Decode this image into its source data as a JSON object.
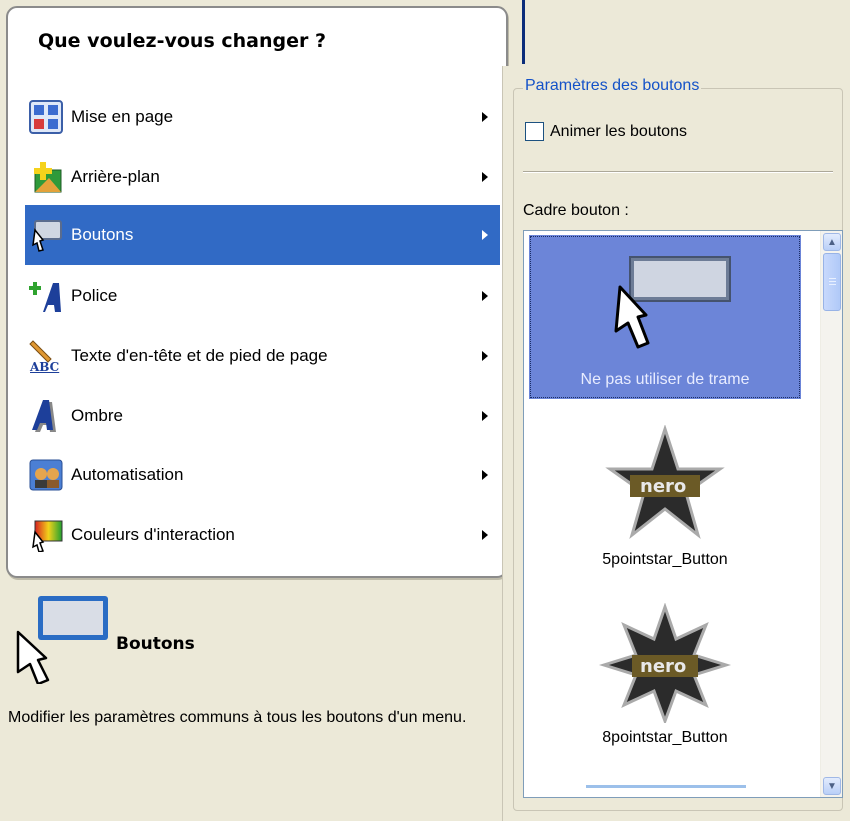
{
  "menu": {
    "title": "Que voulez-vous changer ?",
    "items": [
      {
        "label": "Mise en page",
        "icon": "layout-icon"
      },
      {
        "label": "Arrière-plan",
        "icon": "background-icon"
      },
      {
        "label": "Boutons",
        "icon": "buttons-icon",
        "selected": true
      },
      {
        "label": "Police",
        "icon": "font-icon"
      },
      {
        "label": "Texte d'en-tête et de pied de page",
        "icon": "header-footer-icon"
      },
      {
        "label": "Ombre",
        "icon": "shadow-icon"
      },
      {
        "label": "Automatisation",
        "icon": "automation-icon"
      },
      {
        "label": "Couleurs d'interaction",
        "icon": "interaction-colors-icon"
      }
    ]
  },
  "info": {
    "title": "Boutons",
    "description": "Modifier les paramètres communs à tous les boutons d'un menu."
  },
  "settings": {
    "group_title": "Paramètres des boutons",
    "animate_label": "Animer les boutons",
    "animate_checked": false,
    "frame_label": "Cadre bouton :",
    "frames": [
      {
        "label": "Ne pas utiliser de trame",
        "selected": true
      },
      {
        "label": "5pointstar_Button",
        "selected": false
      },
      {
        "label": "8pointstar_Button",
        "selected": false
      }
    ]
  },
  "colors": {
    "selection": "#316ac5",
    "list_selection": "#6c85d8",
    "legend": "#1452c8"
  }
}
